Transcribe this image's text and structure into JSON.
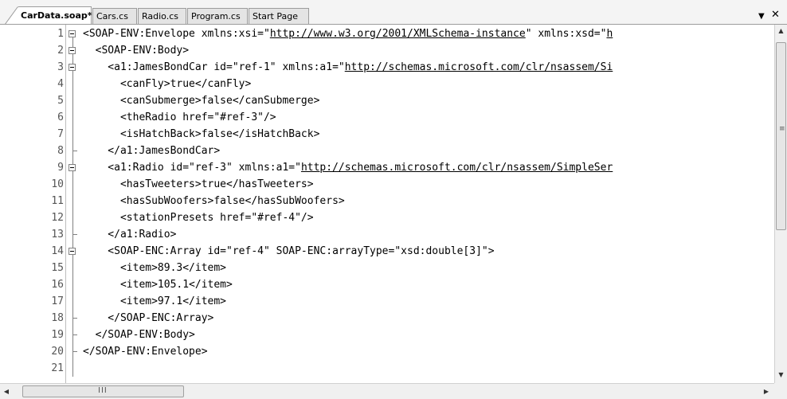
{
  "tabs": [
    {
      "label": "CarData.soap*",
      "active": true
    },
    {
      "label": "Cars.cs",
      "active": false
    },
    {
      "label": "Radio.cs",
      "active": false
    },
    {
      "label": "Program.cs",
      "active": false
    },
    {
      "label": "Start Page",
      "active": false
    }
  ],
  "tab_controls": {
    "dropdown_icon": "chevron-down-icon",
    "close_icon": "close-icon",
    "dropdown_glyph": "▼",
    "close_glyph": "✕"
  },
  "editor": {
    "lines": [
      {
        "num": "1",
        "segments": [
          {
            "t": "<SOAP-ENV:Envelope xmlns:xsi=\""
          },
          {
            "t": "http://www.w3.org/2001/XMLSchema-instance",
            "u": true
          },
          {
            "t": "\" xmlns:xsd=\""
          },
          {
            "t": "h",
            "u": true
          }
        ]
      },
      {
        "num": "2",
        "segments": [
          {
            "t": "  <SOAP-ENV:Body>"
          }
        ]
      },
      {
        "num": "3",
        "segments": [
          {
            "t": "    <a1:JamesBondCar id=\"ref-1\" xmlns:a1=\""
          },
          {
            "t": "http://schemas.microsoft.com/clr/nsassem/Si",
            "u": true
          }
        ]
      },
      {
        "num": "4",
        "segments": [
          {
            "t": "      <canFly>true</canFly>"
          }
        ]
      },
      {
        "num": "5",
        "segments": [
          {
            "t": "      <canSubmerge>false</canSubmerge>"
          }
        ]
      },
      {
        "num": "6",
        "segments": [
          {
            "t": "      <theRadio href=\"#ref-3\"/>"
          }
        ]
      },
      {
        "num": "7",
        "segments": [
          {
            "t": "      <isHatchBack>false</isHatchBack>"
          }
        ]
      },
      {
        "num": "8",
        "segments": [
          {
            "t": "    </a1:JamesBondCar>"
          }
        ]
      },
      {
        "num": "9",
        "segments": [
          {
            "t": "    <a1:Radio id=\"ref-3\" xmlns:a1=\""
          },
          {
            "t": "http://schemas.microsoft.com/clr/nsassem/SimpleSer",
            "u": true
          }
        ]
      },
      {
        "num": "10",
        "segments": [
          {
            "t": "      <hasTweeters>true</hasTweeters>"
          }
        ]
      },
      {
        "num": "11",
        "segments": [
          {
            "t": "      <hasSubWoofers>false</hasSubWoofers>"
          }
        ]
      },
      {
        "num": "12",
        "segments": [
          {
            "t": "      <stationPresets href=\"#ref-4\"/>"
          }
        ]
      },
      {
        "num": "13",
        "segments": [
          {
            "t": "    </a1:Radio>"
          }
        ]
      },
      {
        "num": "14",
        "segments": [
          {
            "t": "    <SOAP-ENC:Array id=\"ref-4\" SOAP-ENC:arrayType=\"xsd:double[3]\">"
          }
        ]
      },
      {
        "num": "15",
        "segments": [
          {
            "t": "      <item>89.3</item>"
          }
        ]
      },
      {
        "num": "16",
        "segments": [
          {
            "t": "      <item>105.1</item>"
          }
        ]
      },
      {
        "num": "17",
        "segments": [
          {
            "t": "      <item>97.1</item>"
          }
        ]
      },
      {
        "num": "18",
        "segments": [
          {
            "t": "    </SOAP-ENC:Array>"
          }
        ]
      },
      {
        "num": "19",
        "segments": [
          {
            "t": "  </SOAP-ENV:Body>"
          }
        ]
      },
      {
        "num": "20",
        "segments": [
          {
            "t": "</SOAP-ENV:Envelope>"
          }
        ]
      },
      {
        "num": "21",
        "segments": [
          {
            "t": ""
          }
        ]
      }
    ]
  },
  "scrollbars": {
    "up_glyph": "▲",
    "down_glyph": "▼",
    "left_glyph": "◀",
    "right_glyph": "▶",
    "v_grip": "≡",
    "h_grip": "III"
  }
}
